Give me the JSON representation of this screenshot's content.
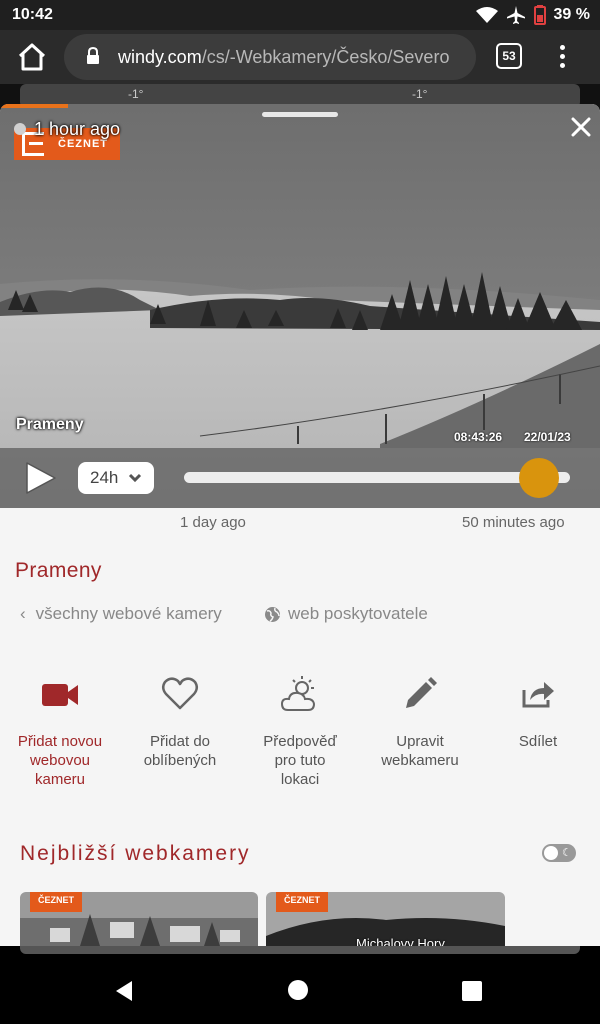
{
  "status_bar": {
    "time": "10:42",
    "battery": "39 %"
  },
  "browser": {
    "url_domain": "windy.com",
    "url_path": "/cs/-Webkamery/Česko/Severo",
    "tab_count": "53"
  },
  "map_strip": {
    "temp_left": "-1°",
    "temp_right": "-1°"
  },
  "camera": {
    "age_label": "1 hour ago",
    "logo_text": "ČEZNET",
    "name_overlay": "Prameny",
    "timestamp_time": "08:43:26",
    "timestamp_date": "22/01/23"
  },
  "player": {
    "range_value": "24h",
    "slider_position_fraction": 0.92,
    "label_left": "1 day ago",
    "label_right": "50 minutes ago"
  },
  "details": {
    "title": "Prameny",
    "link_all": "všechny webové kamery",
    "link_provider": "web poskytovatele"
  },
  "actions": [
    {
      "label_lines": [
        "Přidat novou",
        "webovou",
        "kameru"
      ],
      "icon": "video-camera-icon",
      "primary": true
    },
    {
      "label_lines": [
        "Přidat do",
        "oblíbených"
      ],
      "icon": "heart-icon",
      "primary": false
    },
    {
      "label_lines": [
        "Předpověď",
        "pro tuto",
        "lokaci"
      ],
      "icon": "sun-cloud-icon",
      "primary": false
    },
    {
      "label_lines": [
        "Upravit",
        "webkameru"
      ],
      "icon": "pencil-icon",
      "primary": false
    },
    {
      "label_lines": [
        "Sdílet"
      ],
      "icon": "share-icon",
      "primary": false
    }
  ],
  "nearest": {
    "title": "Nejbližší webkamery",
    "thumb_logo": "ČEZNET",
    "thumb2_caption": "Michalovy Hory"
  },
  "colors": {
    "accent": "#a0282a",
    "slider_thumb": "#d9940d",
    "logo": "#e35a1b"
  }
}
